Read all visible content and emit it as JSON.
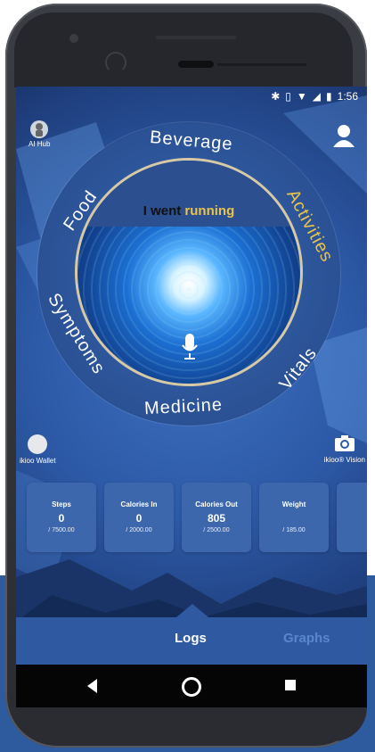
{
  "status_bar": {
    "time": "1:56"
  },
  "header": {
    "ai_hub_label": "AI Hub"
  },
  "wheel": {
    "prompt_prefix": "I went",
    "prompt_highlight": "running",
    "labels": {
      "beverage": "Beverage",
      "activities": "Activities",
      "vitals": "Vitals",
      "medicine": "Medicine",
      "symptoms": "Symptoms",
      "food": "Food"
    }
  },
  "shortcuts": {
    "wallet_label": "ikioo Wallet",
    "vision_label": "ikioo® Vision"
  },
  "cards": [
    {
      "title": "Steps",
      "value": "0",
      "goal": "/ 7500.00"
    },
    {
      "title": "Calories In",
      "value": "0",
      "goal": "/ 2000.00"
    },
    {
      "title": "Calories Out",
      "value": "805",
      "goal": "/ 2500.00"
    },
    {
      "title": "Weight",
      "value": "",
      "goal": "/ 185.00"
    }
  ],
  "tabs": {
    "logs": "Logs",
    "graphs": "Graphs"
  },
  "colors": {
    "accent": "#e9c34b",
    "primary": "#2f5aa2"
  },
  "icons": [
    "bluetooth-icon",
    "vibrate-icon",
    "wifi-icon",
    "signal-icon",
    "battery-icon",
    "user-icon",
    "microphone-icon",
    "camera-icon",
    "back-icon",
    "home-icon",
    "recents-icon"
  ]
}
